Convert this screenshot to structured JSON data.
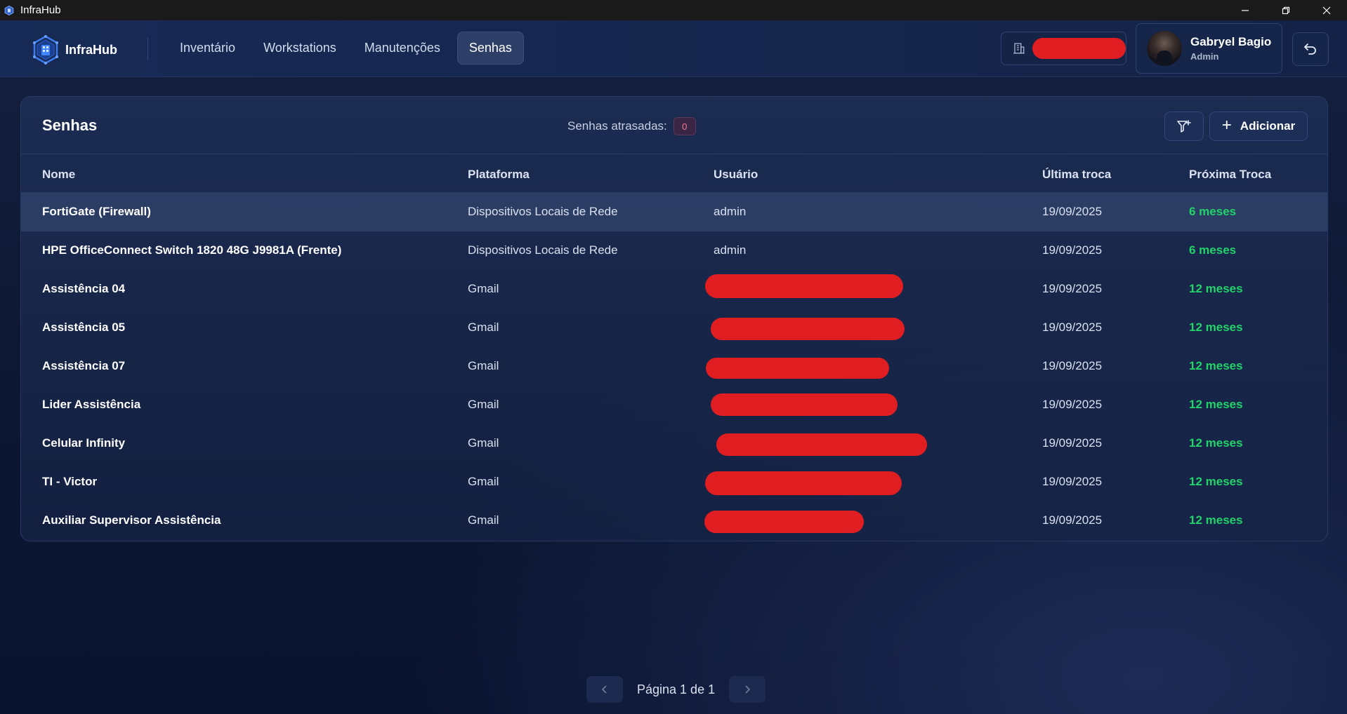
{
  "window": {
    "title": "InfraHub",
    "controls": [
      "minimize-icon",
      "restore-icon",
      "close-icon"
    ]
  },
  "header": {
    "brand": "InfraHub",
    "nav": [
      {
        "label": "Inventário",
        "active": false
      },
      {
        "label": "Workstations",
        "active": false
      },
      {
        "label": "Manutenções",
        "active": false
      },
      {
        "label": "Senhas",
        "active": true
      }
    ],
    "user": {
      "name": "Gabryel Bagio",
      "role": "Admin"
    }
  },
  "panel": {
    "title": "Senhas",
    "overdue_label": "Senhas atrasadas:",
    "overdue_count": "0",
    "add_label": "Adicionar"
  },
  "table": {
    "columns": [
      "Nome",
      "Plataforma",
      "Usuário",
      "Última troca",
      "Próxima Troca"
    ],
    "rows": [
      {
        "name": "FortiGate (Firewall)",
        "platform": "Dispositivos Locais de Rede",
        "user": "admin",
        "last": "19/09/2025",
        "next": "6 meses"
      },
      {
        "name": "HPE OfficeConnect Switch 1820 48G J9981A (Frente)",
        "platform": "Dispositivos Locais de Rede",
        "user": "admin",
        "last": "19/09/2025",
        "next": "6 meses"
      },
      {
        "name": "Assistência 04",
        "platform": "Gmail",
        "user": "",
        "last": "19/09/2025",
        "next": "12 meses"
      },
      {
        "name": "Assistência 05",
        "platform": "Gmail",
        "user": "",
        "last": "19/09/2025",
        "next": "12 meses"
      },
      {
        "name": "Assistência 07",
        "platform": "Gmail",
        "user": "",
        "last": "19/09/2025",
        "next": "12 meses"
      },
      {
        "name": "Lider Assistência",
        "platform": "Gmail",
        "user": "",
        "last": "19/09/2025",
        "next": "12 meses"
      },
      {
        "name": "Celular Infinity",
        "platform": "Gmail",
        "user": "",
        "last": "19/09/2025",
        "next": "12 meses"
      },
      {
        "name": "TI - Victor",
        "platform": "Gmail",
        "user": "",
        "last": "19/09/2025",
        "next": "12 meses"
      },
      {
        "name": "Auxiliar Supervisor Assistência",
        "platform": "Gmail",
        "user": "",
        "last": "19/09/2025",
        "next": "12 meses"
      }
    ]
  },
  "pagination": {
    "label": "Página 1 de 1"
  },
  "colors": {
    "accent_green": "#22d36a",
    "redaction": "#e01e22",
    "badge_pink": "#f27b92"
  }
}
